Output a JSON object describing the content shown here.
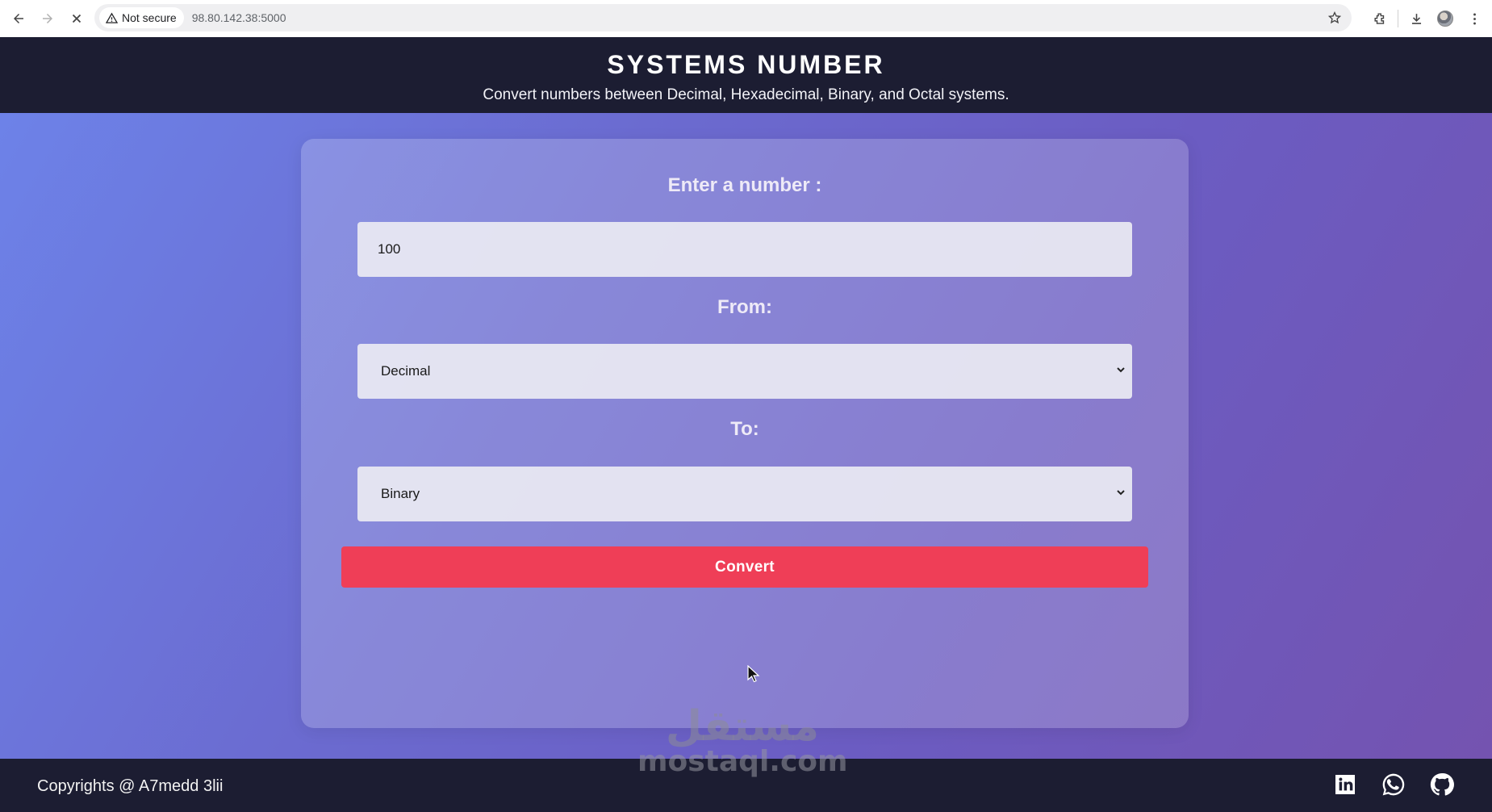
{
  "browser": {
    "security_label": "Not secure",
    "url": "98.80.142.38:5000"
  },
  "header": {
    "title": "SYSTEMS NUMBER",
    "subtitle": "Convert numbers between Decimal, Hexadecimal, Binary, and Octal systems."
  },
  "form": {
    "number_label": "Enter a number :",
    "number_value": "100",
    "from_label": "From:",
    "from_value": "Decimal",
    "to_label": "To:",
    "to_value": "Binary",
    "convert_label": "Convert"
  },
  "footer": {
    "copyright": "Copyrights @ A7medd 3lii"
  },
  "watermark": {
    "logo_text": "مستقل",
    "site": "mostaql.com"
  },
  "colors": {
    "header_bg": "#1c1d32",
    "accent_button": "#ef3e57",
    "gradient_start": "#6d82e8",
    "gradient_end": "#7453b0"
  },
  "icons": [
    "back-icon",
    "forward-icon",
    "stop-icon",
    "warning-icon",
    "star-icon",
    "extensions-icon",
    "download-icon",
    "profile-icon",
    "menu-icon",
    "chevron-down-icon",
    "linkedin-icon",
    "whatsapp-icon",
    "github-icon"
  ]
}
